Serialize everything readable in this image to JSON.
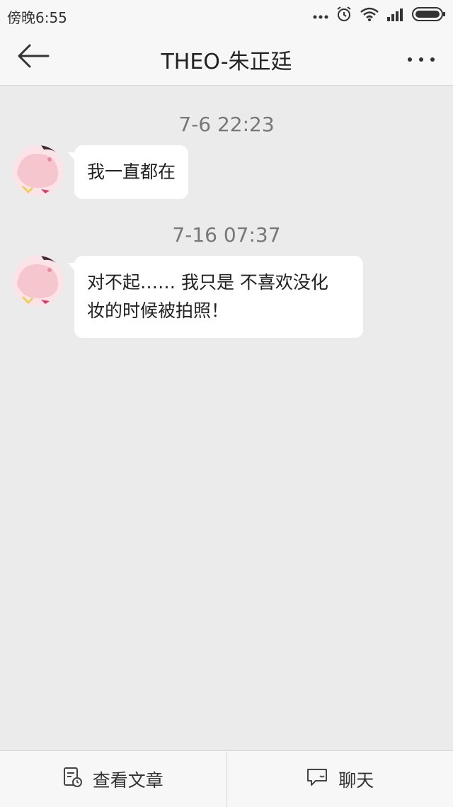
{
  "status_bar": {
    "time": "傍晚6:55",
    "icons": [
      "more-dots-icon",
      "alarm-icon",
      "wifi-icon",
      "signal-icon",
      "battery-icon"
    ]
  },
  "nav": {
    "back_icon": "back-arrow-icon",
    "title": "THEO-朱正廷",
    "more_icon": "more-icon"
  },
  "messages": [
    {
      "timestamp": "7-6 22:23",
      "text": "我一直都在"
    },
    {
      "timestamp": "7-16 07:37",
      "text_line1": "对不起…… 我只是 不喜欢没化",
      "text_line2": "妆的时候被拍照！"
    }
  ],
  "bottom_bar": {
    "articles_label": "查看文章",
    "articles_icon": "article-icon",
    "chat_label": "聊天",
    "chat_icon": "chat-icon"
  },
  "colors": {
    "background": "#ebebeb",
    "bar": "#f7f7f7",
    "bubble": "#ffffff",
    "timestamp": "#777777"
  }
}
